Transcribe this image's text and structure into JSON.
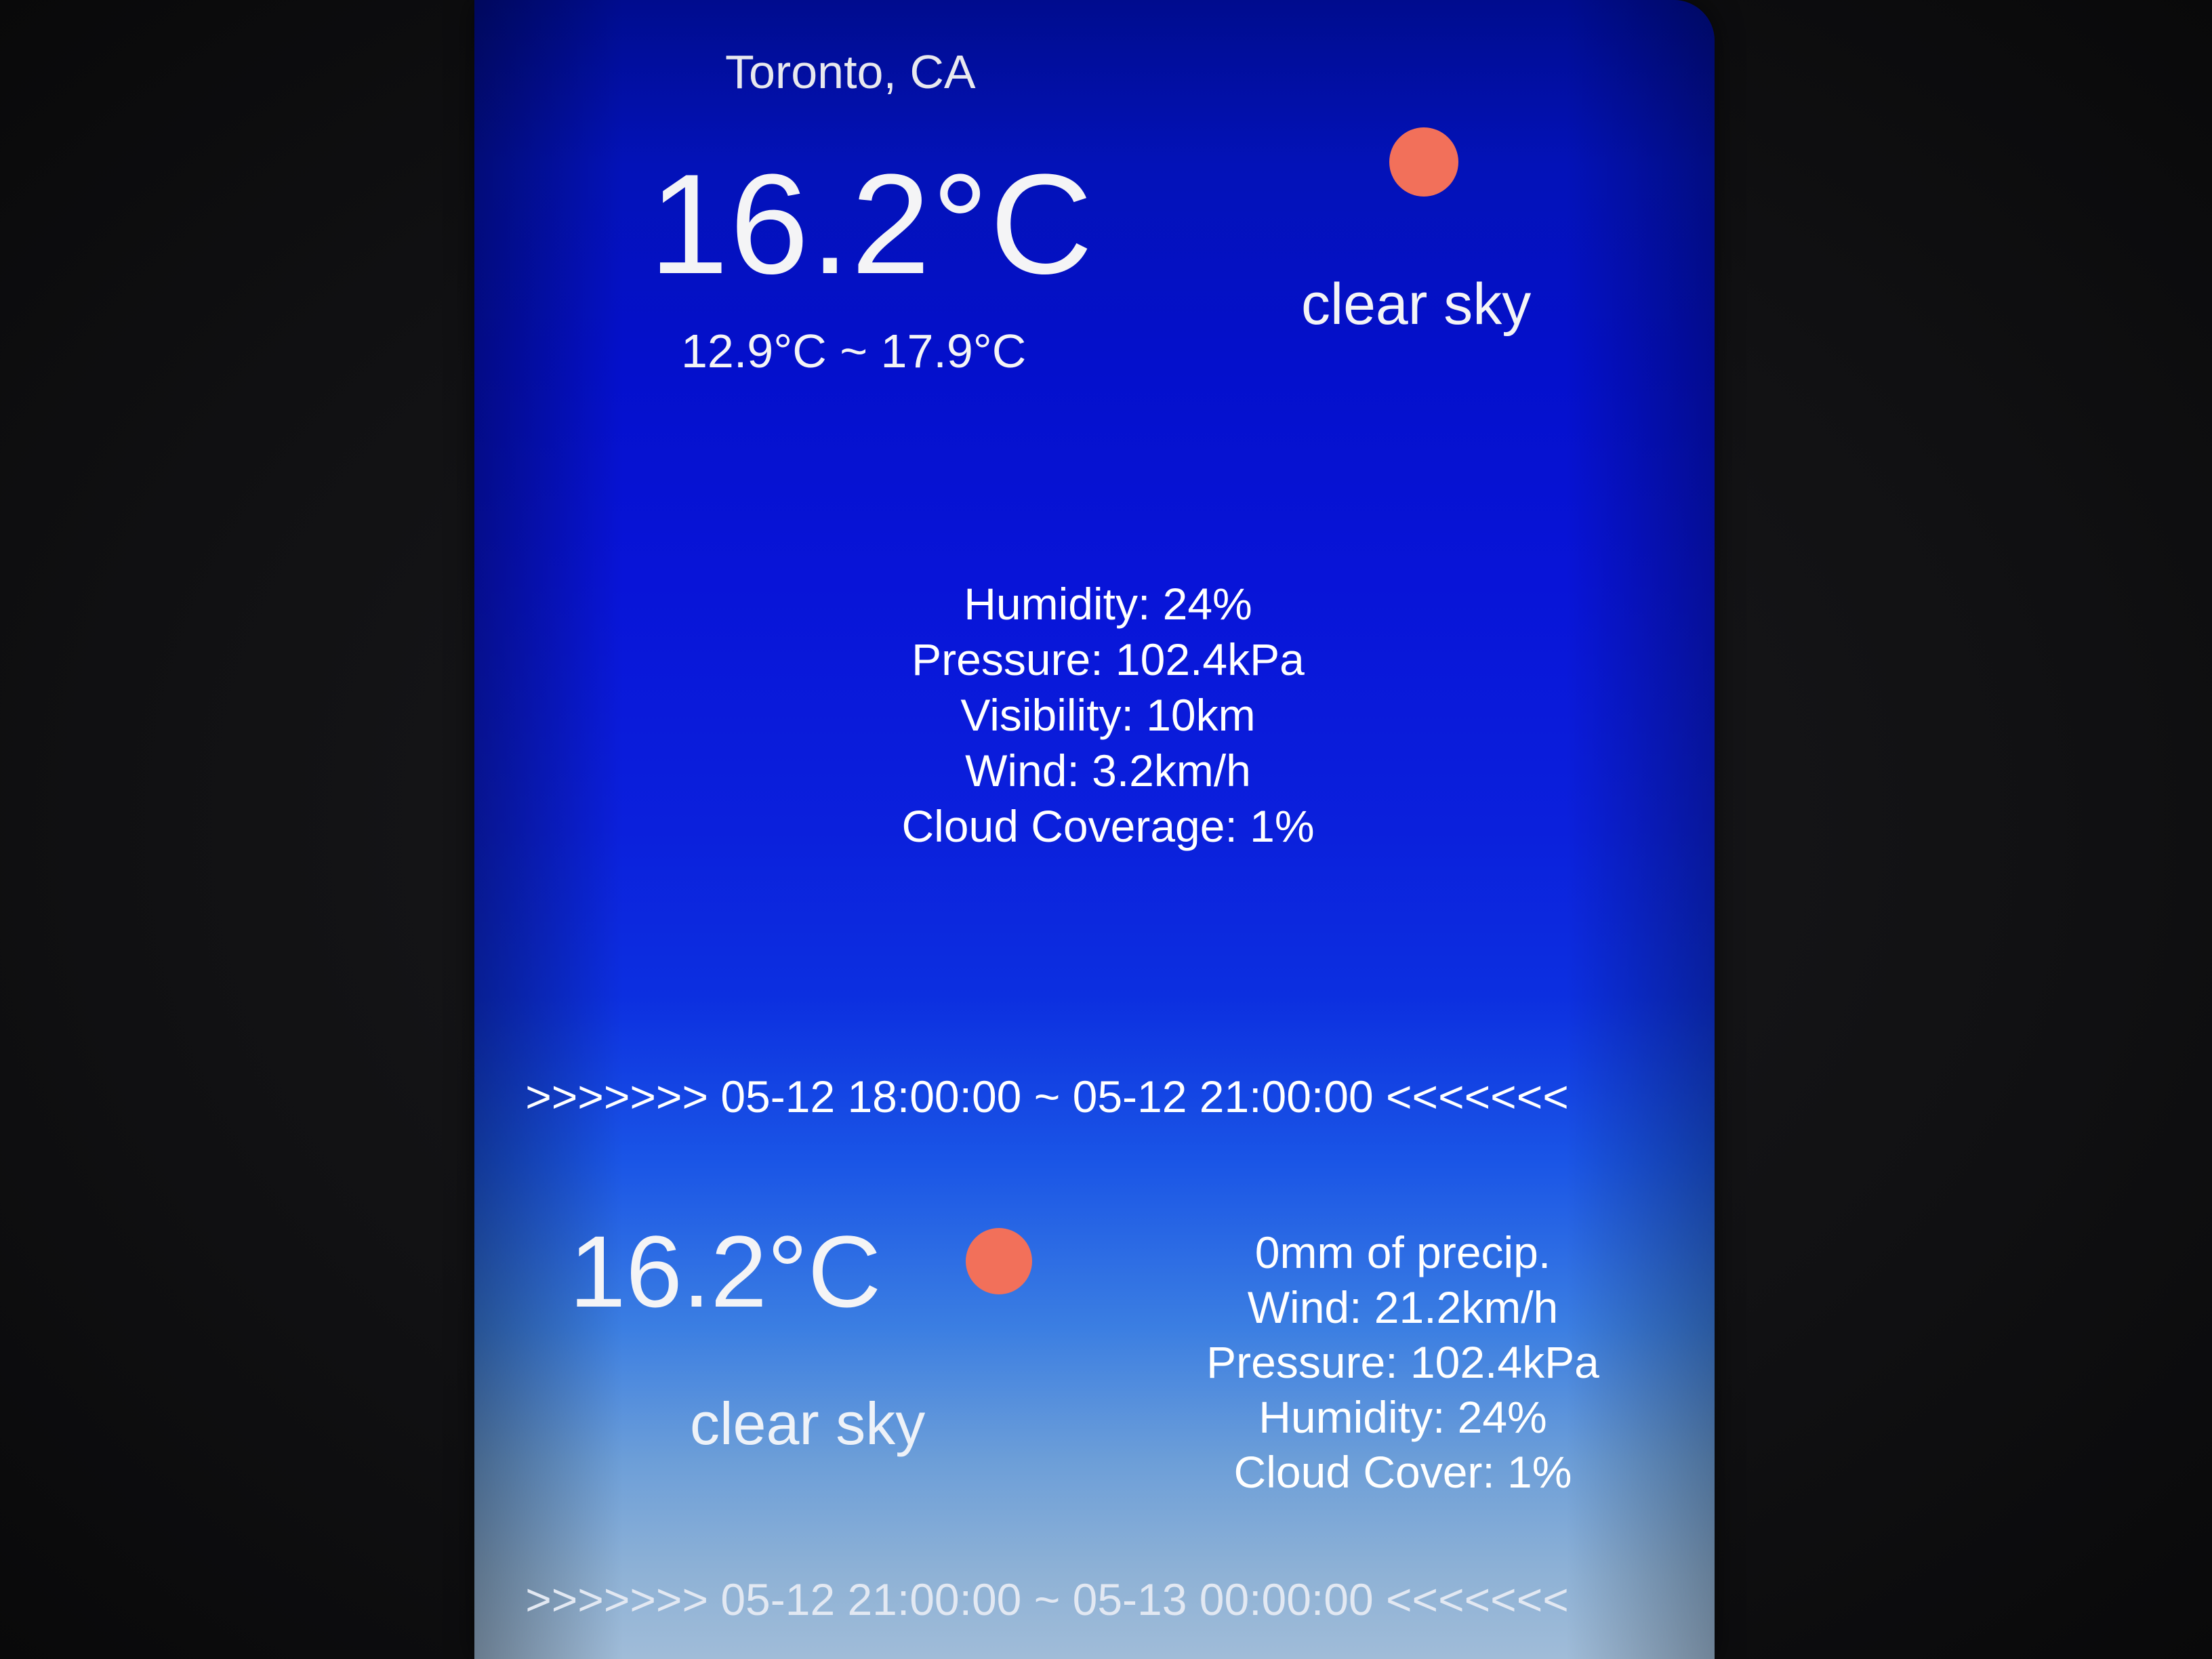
{
  "current": {
    "location": "Toronto, CA",
    "temperature": "16.2°C",
    "range": "12.9°C ~ 17.9°C",
    "condition": "clear sky",
    "icon": "sun-icon",
    "sun_color": "#f2705a",
    "details": [
      "Humidity: 24%",
      "Pressure: 102.4kPa",
      "Visibility: 10km",
      "Wind: 3.2km/h",
      "Cloud Coverage: 1%"
    ]
  },
  "forecast": [
    {
      "period": ">>>>>>> 05-12 18:00:00 ~ 05-12 21:00:00 <<<<<<<",
      "temperature": "16.2°C",
      "condition": "clear sky",
      "icon": "sun-icon",
      "details": [
        "0mm of precip.",
        "Wind: 21.2km/h",
        "Pressure: 102.4kPa",
        "Humidity: 24%",
        "Cloud Cover: 1%"
      ]
    },
    {
      "period": ">>>>>>> 05-12 21:00:00 ~ 05-13 00:00:00 <<<<<<<"
    }
  ]
}
